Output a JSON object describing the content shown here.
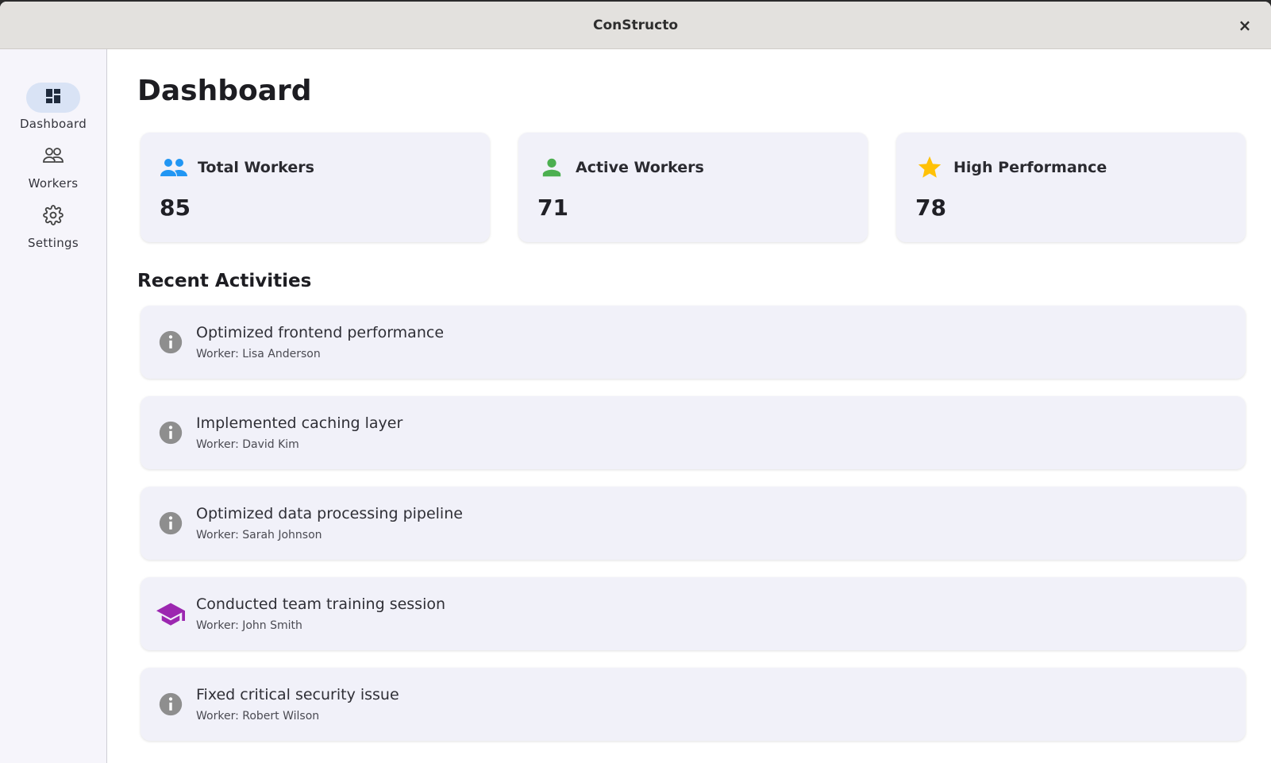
{
  "window": {
    "title": "ConStructo",
    "close_glyph": "×"
  },
  "sidebar": {
    "items": [
      {
        "label": "Dashboard",
        "icon": "dashboard-icon",
        "active": true
      },
      {
        "label": "Workers",
        "icon": "people-outline-icon",
        "active": false
      },
      {
        "label": "Settings",
        "icon": "gear-icon",
        "active": false
      }
    ]
  },
  "main": {
    "title": "Dashboard",
    "stats": [
      {
        "label": "Total Workers",
        "value": "85",
        "icon": "people-icon",
        "color": "#2196f3"
      },
      {
        "label": "Active Workers",
        "value": "71",
        "icon": "person-icon",
        "color": "#4caf50"
      },
      {
        "label": "High Performance",
        "value": "78",
        "icon": "star-icon",
        "color": "#ffc107"
      }
    ],
    "recent_title": "Recent Activities",
    "activities": [
      {
        "title": "Optimized frontend performance",
        "worker": "Worker: Lisa Anderson",
        "icon": "info-icon"
      },
      {
        "title": "Implemented caching layer",
        "worker": "Worker: David Kim",
        "icon": "info-icon"
      },
      {
        "title": "Optimized data processing pipeline",
        "worker": "Worker: Sarah Johnson",
        "icon": "info-icon"
      },
      {
        "title": "Conducted team training session",
        "worker": "Worker: John Smith",
        "icon": "graduation-cap-icon",
        "color": "#9c27b0"
      },
      {
        "title": "Fixed critical security issue",
        "worker": "Worker: Robert Wilson",
        "icon": "info-icon"
      }
    ]
  }
}
